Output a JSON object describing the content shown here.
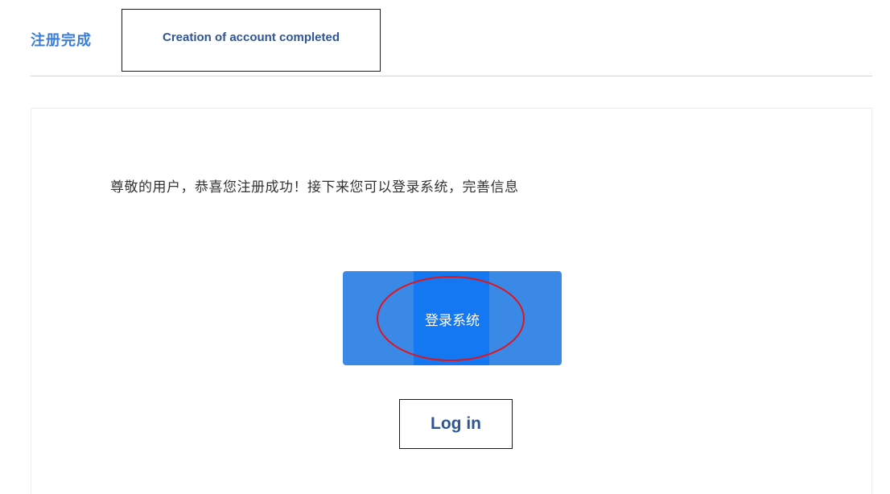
{
  "header": {
    "title": "注册完成"
  },
  "annotations": {
    "title_translation": "Creation of account completed",
    "login_translation": "Log in",
    "highlight_color": "#e0141e",
    "annotation_text_color": "#2f5597"
  },
  "main": {
    "message": "尊敬的用户，恭喜您注册成功！接下来您可以登录系统，完善信息",
    "login_button_label": "登录系统"
  },
  "colors": {
    "accent": "#3d7ed6",
    "button": "#3b89e6",
    "button_focus": "#1478f2"
  }
}
